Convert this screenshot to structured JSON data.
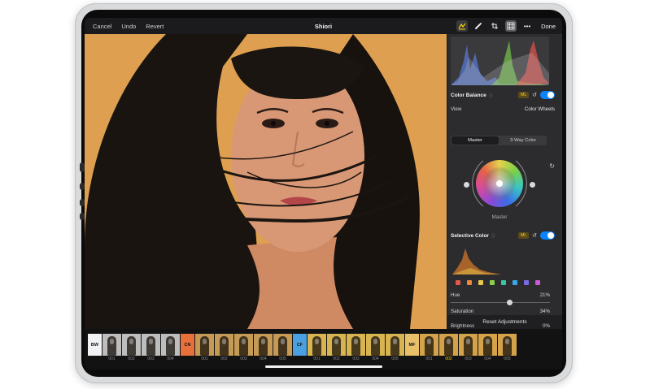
{
  "toolbar": {
    "cancel": "Cancel",
    "undo": "Undo",
    "revert": "Revert",
    "title": "Shiori",
    "done": "Done",
    "icons": [
      "adjust-icon",
      "brush-icon",
      "crop-icon",
      "grid-icon",
      "more-icon"
    ]
  },
  "colors": {
    "accent": "#ffd60a",
    "toggle": "#0a84ff",
    "panel_bg": "#2c2c2e",
    "photo_bg": "#e0a452"
  },
  "color_balance": {
    "title": "Color Balance",
    "ml_badge": "ML",
    "enabled": true,
    "view_label": "View",
    "view_value": "Color Wheels",
    "segments": [
      "Master",
      "3-Way Color"
    ],
    "selected_segment": "Master",
    "wheel_label": "Master"
  },
  "selective_color": {
    "title": "Selective Color",
    "ml_badge": "ML",
    "enabled": true,
    "swatches": [
      "#e0584a",
      "#e88a3a",
      "#e8c84a",
      "#8ad04a",
      "#3ac6a0",
      "#3aa6e6",
      "#7a6ae6",
      "#c85ad8"
    ],
    "sliders": [
      {
        "label": "Hue",
        "value": "21%",
        "level": 0.6
      },
      {
        "label": "Saturation",
        "value": "34%",
        "level": 0.67
      },
      {
        "label": "Brightness",
        "value": "0%",
        "level": 0.5
      }
    ]
  },
  "reset_label": "Reset Adjustments",
  "filters": [
    {
      "code": "BW",
      "color": "#f2f2f5",
      "tint": "#bdbdbd",
      "items": [
        "001",
        "002",
        "003",
        "004"
      ]
    },
    {
      "code": "CN",
      "color": "#e8703a",
      "tint": "#c59a55",
      "items": [
        "001",
        "002",
        "003",
        "004",
        "005"
      ]
    },
    {
      "code": "CF",
      "color": "#4aa0e0",
      "tint": "#d8b450",
      "items": [
        "001",
        "002",
        "003",
        "004",
        "005"
      ]
    },
    {
      "code": "MF",
      "color": "#e8c06a",
      "tint": "#d3a24a",
      "items": [
        "001",
        "002",
        "003",
        "004",
        "005"
      ]
    }
  ],
  "selected_filter": "MF 002"
}
